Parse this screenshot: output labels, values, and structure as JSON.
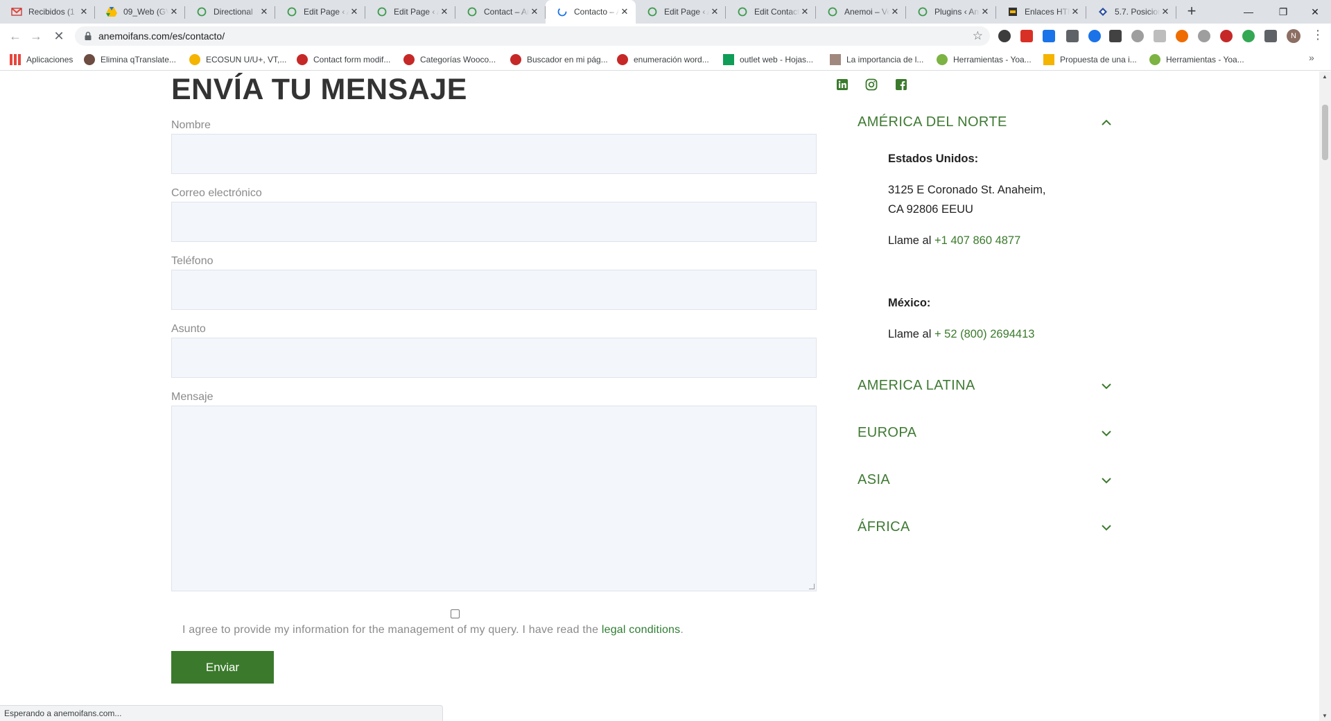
{
  "browser": {
    "tabs": [
      {
        "label": "Recibidos (1",
        "icon": "gmail-icon"
      },
      {
        "label": "09_Web (GV",
        "icon": "drive-icon"
      },
      {
        "label": "Directional",
        "icon": "site-icon"
      },
      {
        "label": "Edit Page ‹ A",
        "icon": "site-icon"
      },
      {
        "label": "Edit Page ‹ A",
        "icon": "site-icon"
      },
      {
        "label": "Contact – An",
        "icon": "site-icon"
      },
      {
        "label": "Contacto – A",
        "icon": "loading-icon"
      },
      {
        "label": "Edit Page ‹ A",
        "icon": "site-icon"
      },
      {
        "label": "Edit Contact",
        "icon": "site-icon"
      },
      {
        "label": "Anemoi – Ve",
        "icon": "site-icon"
      },
      {
        "label": "Plugins ‹ An",
        "icon": "site-icon"
      },
      {
        "label": "Enlaces HTM",
        "icon": "html-icon"
      },
      {
        "label": "5.7. Posicion",
        "icon": "doc-icon"
      }
    ],
    "active_tab_index": 6,
    "url": "anemoifans.com/es/contacto/",
    "avatar_letter": "N",
    "bookmarks": [
      {
        "label": "Aplicaciones",
        "color": "#e8453c"
      },
      {
        "label": "Elimina qTranslate...",
        "color": "#6d4c41"
      },
      {
        "label": "ECOSUN U/U+, VT,...",
        "color": "#f4b400"
      },
      {
        "label": "Contact form modif...",
        "color": "#c62828"
      },
      {
        "label": "Categorías Wooco...",
        "color": "#c62828"
      },
      {
        "label": "Buscador en mi pág...",
        "color": "#c62828"
      },
      {
        "label": "enumeración word...",
        "color": "#c62828"
      },
      {
        "label": "outlet web - Hojas...",
        "color": "#0f9d58"
      },
      {
        "label": "La importancia de l...",
        "color": "#a1887f"
      },
      {
        "label": "Herramientas - Yoa...",
        "color": "#7cb342"
      },
      {
        "label": "Propuesta de una i...",
        "color": "#f4b400"
      },
      {
        "label": "Herramientas - Yoa...",
        "color": "#7cb342"
      }
    ],
    "status_text": "Esperando a anemoifans.com..."
  },
  "form": {
    "title": "ENVÍA TU MENSAJE",
    "fields": [
      {
        "label": "Nombre",
        "value": ""
      },
      {
        "label": "Correo electrónico",
        "value": ""
      },
      {
        "label": "Teléfono",
        "value": ""
      },
      {
        "label": "Asunto",
        "value": ""
      }
    ],
    "message_label": "Mensaje",
    "consent_text": "I agree to provide my information for the management of my query. I have read the ",
    "consent_link": "legal conditions",
    "consent_end": ".",
    "submit_label": "Enviar"
  },
  "social": [
    "linkedin-icon",
    "instagram-icon",
    "facebook-icon"
  ],
  "regions": {
    "north_america": {
      "title": "AMÉRICA DEL NORTE",
      "expanded": true,
      "usa_heading": "Estados Unidos:",
      "usa_address_1": "3125 E Coronado St. Anaheim,",
      "usa_address_2": "CA 92806 EEUU",
      "call_prefix": "Llame al ",
      "usa_phone": "+1 407 860 4877",
      "mexico_heading": "México:",
      "mexico_phone": "+ 52 (800) 2694413"
    },
    "collapsed": [
      "AMERICA LATINA",
      "EUROPA",
      "ASIA",
      "ÁFRICA"
    ]
  },
  "colors": {
    "accent": "#3b7a2c",
    "input_bg": "#f3f6fb",
    "title": "#333333"
  }
}
